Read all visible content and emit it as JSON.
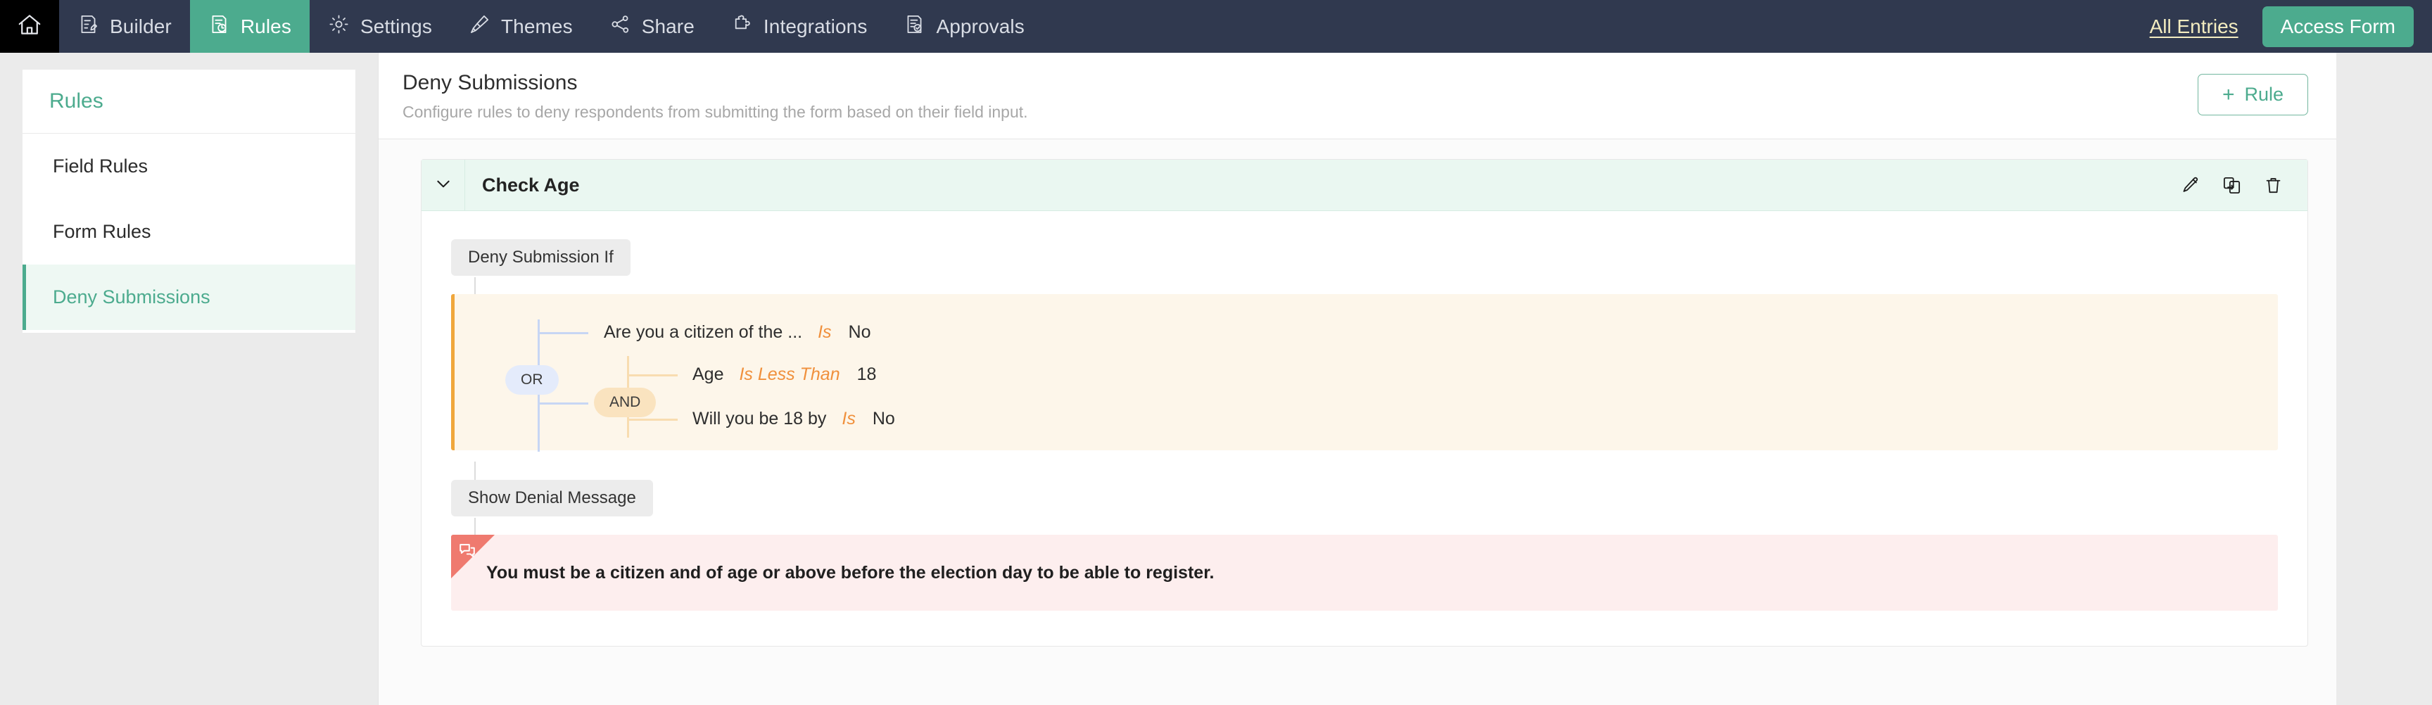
{
  "topnav": {
    "home_icon": "home-icon",
    "tabs": [
      {
        "label": "Builder",
        "icon": "builder-icon",
        "active": false
      },
      {
        "label": "Rules",
        "icon": "rules-icon",
        "active": true
      },
      {
        "label": "Settings",
        "icon": "gear-icon",
        "active": false
      },
      {
        "label": "Themes",
        "icon": "brush-icon",
        "active": false
      },
      {
        "label": "Share",
        "icon": "share-icon",
        "active": false
      },
      {
        "label": "Integrations",
        "icon": "puzzle-icon",
        "active": false
      },
      {
        "label": "Approvals",
        "icon": "approvals-icon",
        "active": false
      }
    ],
    "all_entries_label": "All Entries",
    "access_form_label": "Access Form",
    "accent_color": "#4cab8e",
    "bar_color": "#30394f",
    "link_color": "#f3ecc0"
  },
  "sidebar": {
    "title": "Rules",
    "items": [
      {
        "label": "Field Rules",
        "active": false
      },
      {
        "label": "Form Rules",
        "active": false
      },
      {
        "label": "Deny Submissions",
        "active": true
      }
    ],
    "active_color": "#4cab8e",
    "active_bg": "#eef8f3"
  },
  "main": {
    "title": "Deny Submissions",
    "subtitle": "Configure rules to deny respondents from submitting the form based on their field input.",
    "add_rule_label": "Rule",
    "add_rule_plus": "+"
  },
  "rule": {
    "name": "Check Age",
    "collapse_icon": "chevron-down-icon",
    "actions": [
      {
        "name": "edit-rule-icon",
        "title": "Edit"
      },
      {
        "name": "duplicate-rule-icon",
        "title": "Duplicate"
      },
      {
        "name": "delete-rule-icon",
        "title": "Delete"
      }
    ],
    "condition_tag": "Deny Submission If",
    "action_tag": "Show Denial Message",
    "logic": {
      "outer_operator": "OR",
      "inner_operator": "AND",
      "panel_bg": "#fdf6ea",
      "panel_accent": "#f0a73c",
      "or_badge_bg": "#e4ebfb",
      "and_badge_bg": "#fae3bf",
      "operator_text_color": "#f0903c"
    },
    "conditions": [
      {
        "field": "Are you a citizen of the ...",
        "operator": "Is",
        "value": "No"
      },
      {
        "field": "Age",
        "operator": "Is Less Than",
        "value": "18"
      },
      {
        "field": "Will you be 18 by",
        "operator": "Is",
        "value": "No"
      }
    ],
    "denial_message": "You must be a citizen and of age or above before the election day to be able to register.",
    "denial_icon": "message-flag-icon",
    "denial_bg": "#fdeeee",
    "denial_corner_color": "#ef7a6f"
  }
}
